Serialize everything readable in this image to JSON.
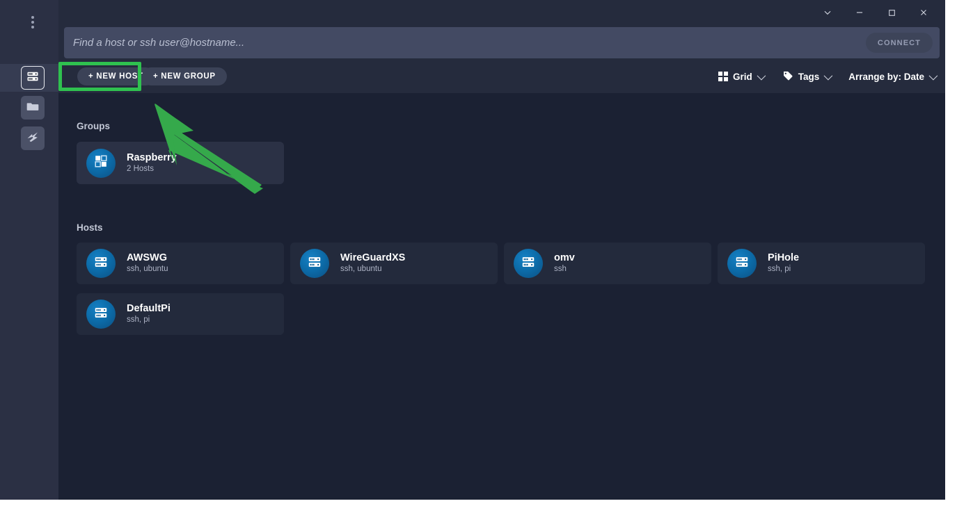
{
  "window": {
    "controls": [
      {
        "name": "chevron-down-icon",
        "glyph": "⌄"
      },
      {
        "name": "minimize-icon",
        "glyph": "−"
      },
      {
        "name": "maximize-icon",
        "glyph": "□"
      },
      {
        "name": "close-icon",
        "glyph": "✕"
      }
    ]
  },
  "search": {
    "value": "",
    "placeholder": "Find a host or ssh user@hostname...",
    "connect_label": "CONNECT"
  },
  "toolbar": {
    "new_host_label": "+ NEW HOST",
    "new_group_label": "+ NEW GROUP",
    "view_label": "Grid",
    "tags_label": "Tags",
    "arrange_label": "Arrange by: Date"
  },
  "sidebar": {
    "items": [
      {
        "name": "overflow-menu-icon",
        "label": ""
      },
      {
        "name": "hosts-icon",
        "label": "",
        "active": true
      },
      {
        "name": "folder-icon",
        "label": ""
      },
      {
        "name": "port-forwarding-icon",
        "label": ""
      }
    ]
  },
  "sections": {
    "groups_label": "Groups",
    "hosts_label": "Hosts"
  },
  "groups": [
    {
      "title": "Raspberry",
      "subtitle": "2 Hosts",
      "icon": "group-icon"
    }
  ],
  "hosts": [
    {
      "title": "AWSWG",
      "subtitle": "ssh, ubuntu",
      "icon": "server-icon"
    },
    {
      "title": "WireGuardXS",
      "subtitle": "ssh, ubuntu",
      "icon": "server-icon"
    },
    {
      "title": "omv",
      "subtitle": "ssh",
      "icon": "server-icon"
    },
    {
      "title": "PiHole",
      "subtitle": "ssh, pi",
      "icon": "server-icon"
    },
    {
      "title": "DefaultPi",
      "subtitle": "ssh, pi",
      "icon": "server-icon"
    }
  ],
  "annotation": {
    "highlight_color": "#2fc14f",
    "arrow_color": "#35a94b",
    "target": "+ NEW HOST"
  },
  "colors": {
    "window_bg": "#1b2133",
    "rail_bg": "#2b3044",
    "bar_bg": "#252b3d",
    "search_bg": "#434a63",
    "card_host_bg": "#232a3c",
    "card_group_bg": "#2b3145",
    "accent_blue": "#0c6ba8"
  }
}
